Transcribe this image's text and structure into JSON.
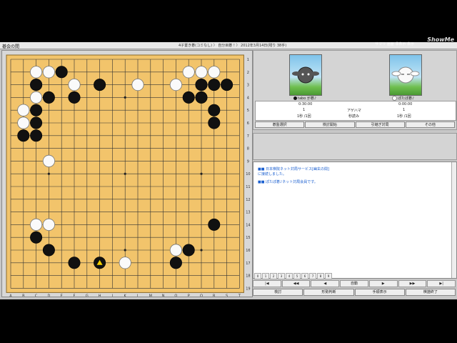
{
  "window": {
    "title": "碁会の間",
    "game_info": "4子置き碁(コミなし) 〉 自分目碁 ! 〉 2012年3月14日(残り 38手)",
    "watermark": "ShowMe",
    "title_buttons": "サマリ 画面 非表示 表示"
  },
  "board": {
    "size": 19,
    "col_labels": [
      "A",
      "B",
      "C",
      "D",
      "E",
      "F",
      "G",
      "H",
      "J",
      "K",
      "L",
      "M",
      "N",
      "O",
      "P",
      "Q",
      "R",
      "S",
      "T"
    ],
    "row_labels": [
      "1",
      "2",
      "3",
      "4",
      "5",
      "6",
      "7",
      "8",
      "9",
      "10",
      "11",
      "12",
      "13",
      "14",
      "15",
      "16",
      "17",
      "18",
      "19"
    ],
    "black_stones": [
      [
        4,
        1
      ],
      [
        7,
        2
      ],
      [
        2,
        2
      ],
      [
        3,
        3
      ],
      [
        5,
        3
      ],
      [
        2,
        4
      ],
      [
        2,
        5
      ],
      [
        1,
        6
      ],
      [
        2,
        6
      ],
      [
        15,
        2
      ],
      [
        16,
        2
      ],
      [
        14,
        3
      ],
      [
        15,
        3
      ],
      [
        16,
        4
      ],
      [
        17,
        2
      ],
      [
        16,
        5
      ],
      [
        2,
        14
      ],
      [
        3,
        15
      ],
      [
        5,
        16
      ],
      [
        7,
        16
      ],
      [
        14,
        15
      ],
      [
        13,
        16
      ],
      [
        16,
        13
      ]
    ],
    "white_stones": [
      [
        2,
        1
      ],
      [
        3,
        1
      ],
      [
        2,
        2
      ],
      [
        5,
        2
      ],
      [
        2,
        3
      ],
      [
        1,
        4
      ],
      [
        1,
        5
      ],
      [
        10,
        2
      ],
      [
        13,
        2
      ],
      [
        14,
        1
      ],
      [
        15,
        1
      ],
      [
        16,
        1
      ],
      [
        15,
        2
      ],
      [
        3,
        8
      ],
      [
        2,
        13
      ],
      [
        3,
        13
      ],
      [
        9,
        16
      ],
      [
        13,
        15
      ],
      [
        13,
        16
      ]
    ],
    "last_move": [
      7,
      16
    ]
  },
  "players": {
    "black_name": "tabo が碁♪",
    "white_name": "ぽたぽ碁♪",
    "black_time": "0:30:00",
    "white_time": "0:00:00",
    "komi_label": "アゲハマ",
    "black_captures": "1",
    "white_captures": "1",
    "black_byoyomi": "1秒 /1回",
    "byoyomi_label": "秒読み",
    "white_byoyomi": "1秒 /1回"
  },
  "action_buttons": [
    "碁盤選択",
    "検討開始",
    "引継ぎ対局",
    "その他"
  ],
  "chat": {
    "messages": [
      "■■ 日本棋院ネット対局サービス[幽玄の間]",
      "に接続しました。",
      "■■ ぽたぽ碁♪ネット対局会員です。"
    ]
  },
  "tabs": [
    "0",
    "1",
    "2",
    "3",
    "4",
    "5",
    "6",
    "7",
    "8",
    "9"
  ],
  "move_nav": [
    "|◀",
    "◀◀",
    "◀",
    "自動",
    "▶",
    "▶▶",
    "▶|"
  ],
  "bottom_buttons": [
    "検討",
    "形勢判断",
    "手順表示",
    "棋譜終了"
  ]
}
